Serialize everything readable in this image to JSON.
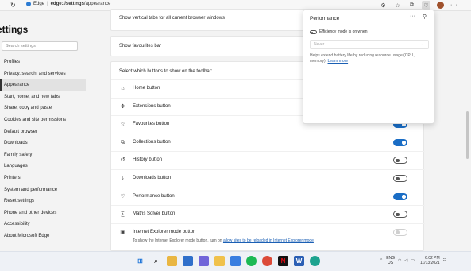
{
  "browser": {
    "site_label": "Edge",
    "url_bold": "edge://settings",
    "url_rest": "/appearance"
  },
  "sidebar": {
    "title": "ettings",
    "search_placeholder": "Search settings",
    "items": [
      {
        "label": "Profiles"
      },
      {
        "label": "Privacy, search, and services"
      },
      {
        "label": "Appearance"
      },
      {
        "label": "Start, home, and new tabs"
      },
      {
        "label": "Share, copy and paste"
      },
      {
        "label": "Cookies and site permissions"
      },
      {
        "label": "Default browser"
      },
      {
        "label": "Downloads"
      },
      {
        "label": "Family safety"
      },
      {
        "label": "Languages"
      },
      {
        "label": "Printers"
      },
      {
        "label": "System and performance"
      },
      {
        "label": "Reset settings"
      },
      {
        "label": "Phone and other devices"
      },
      {
        "label": "Accessibility"
      },
      {
        "label": "About Microsoft Edge"
      }
    ],
    "active_index": 2
  },
  "main": {
    "vertical_tabs_label": "Show vertical tabs for all current browser windows",
    "favourites_bar_label": "Show favourites bar",
    "toolbar_heading": "Select which buttons to show on the toolbar:",
    "buttons": [
      {
        "label": "Home button",
        "icon": "home-icon",
        "on": null
      },
      {
        "label": "Extensions button",
        "icon": "puzzle-icon",
        "on": null
      },
      {
        "label": "Favourites button",
        "icon": "star-icon",
        "on": true
      },
      {
        "label": "Collections button",
        "icon": "collections-icon",
        "on": true
      },
      {
        "label": "History button",
        "icon": "history-icon",
        "on": false
      },
      {
        "label": "Downloads button",
        "icon": "download-icon",
        "on": false
      },
      {
        "label": "Performance button",
        "icon": "heartbeat-icon",
        "on": true
      },
      {
        "label": "Maths Solver button",
        "icon": "math-icon",
        "on": false
      }
    ],
    "ie_mode": {
      "label": "Internet Explorer mode button",
      "sub_prefix": "To show the Internet Explorer mode button, turn on",
      "sub_link": "allow sites to be reloaded in Internet Explorer mode"
    }
  },
  "popup": {
    "title": "Performance",
    "efficiency_label": "Efficiency mode is on when",
    "select_value": "Never",
    "description": "Helps extend battery life by reducing resource usage (CPU, memory).",
    "learn_more": "Learn more"
  },
  "taskbar": {
    "lang_top": "ENG",
    "lang_bottom": "US",
    "time": "6:02 PM",
    "date": "11/13/2021"
  },
  "colors": {
    "accent": "#1a6dc5",
    "background": "#f3f3f3",
    "card": "#ffffff"
  }
}
